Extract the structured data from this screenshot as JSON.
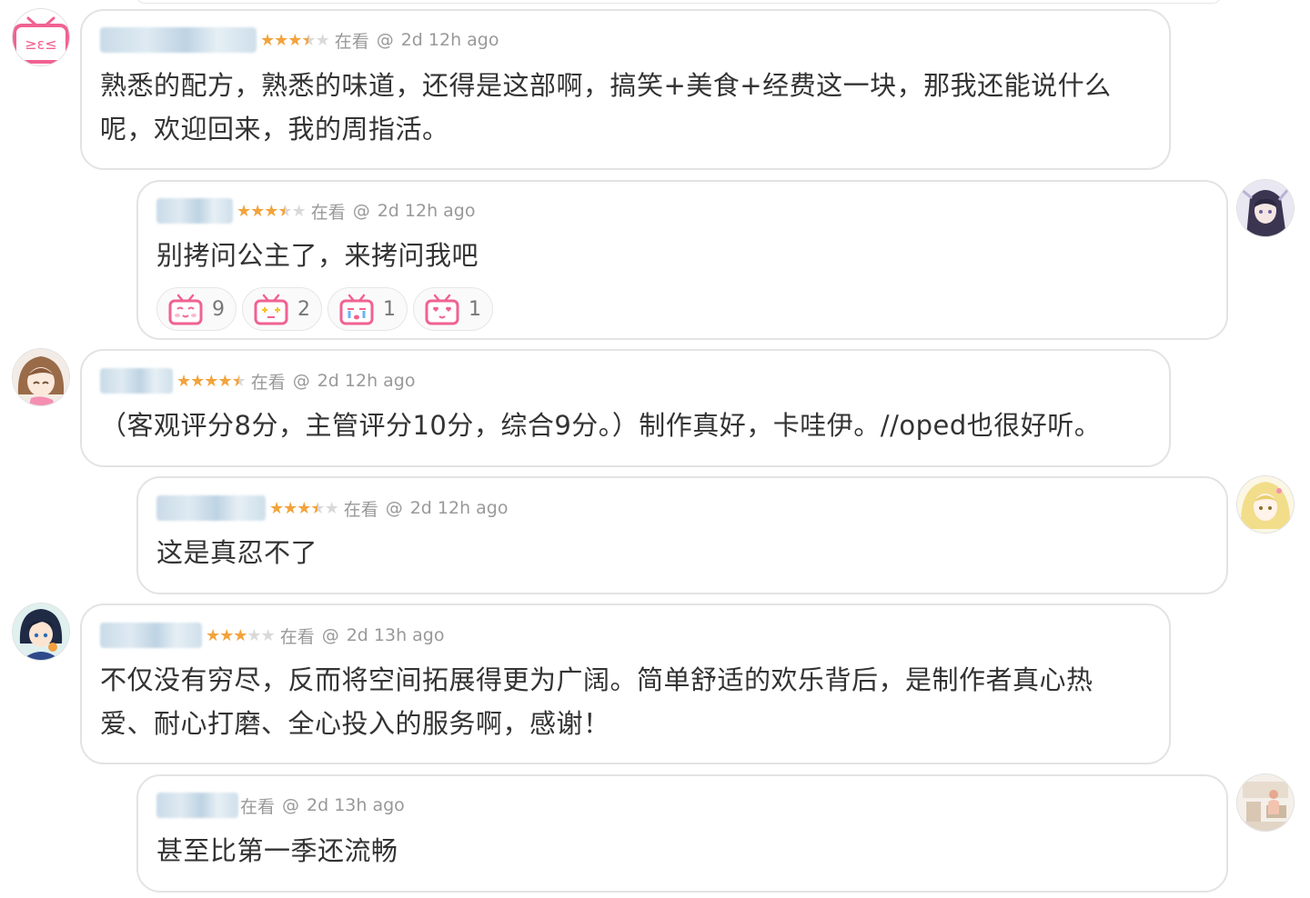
{
  "comments": [
    {
      "status": "在看",
      "at": "@",
      "time": "2d 12h ago",
      "rating": 3.5,
      "text": "熟悉的配方，熟悉的味道，还得是这部啊，搞笑+美食+经费这一块，那我还能说什么呢，欢迎回来，我的周指活。",
      "avatar": "tv-mascot-avatar",
      "avatar_side": "left"
    },
    {
      "status": "在看",
      "at": "@",
      "time": "2d 12h ago",
      "rating": 3.5,
      "text": "别拷问公主了，来拷问我吧",
      "avatar": "anime-girl-avatar",
      "avatar_side": "right",
      "reactions": [
        {
          "icon": "tv-blush-icon",
          "count": "9"
        },
        {
          "icon": "tv-sparkle-icon",
          "count": "2"
        },
        {
          "icon": "tv-cry-icon",
          "count": "1"
        },
        {
          "icon": "tv-love-icon",
          "count": "1"
        }
      ]
    },
    {
      "status": "在看",
      "at": "@",
      "time": "2d 12h ago",
      "rating": 4.5,
      "text": "（客观评分8分，主管评分10分，综合9分。）制作真好，卡哇伊。//oped也很好听。",
      "avatar": "brown-hair-girl-avatar",
      "avatar_side": "left"
    },
    {
      "status": "在看",
      "at": "@",
      "time": "2d 12h ago",
      "rating": 3.5,
      "text": "这是真忍不了",
      "avatar": "blonde-girl-avatar",
      "avatar_side": "right"
    },
    {
      "status": "在看",
      "at": "@",
      "time": "2d 13h ago",
      "rating": 3,
      "text": "不仅没有穷尽，反而将空间拓展得更为广阔。简单舒适的欢乐背后，是制作者真心热爱、耐心打磨、全心投入的服务啊，感谢！",
      "avatar": "dark-hair-boy-avatar",
      "avatar_side": "left"
    },
    {
      "status": "在看",
      "at": "@",
      "time": "2d 13h ago",
      "rating": null,
      "text": "甚至比第一季还流畅",
      "avatar": "room-scene-avatar",
      "avatar_side": "right"
    }
  ],
  "colors": {
    "star": "#f2a33c",
    "star_off": "#d9d9d9",
    "meta": "#999999",
    "mascot_pink": "#f06292"
  }
}
